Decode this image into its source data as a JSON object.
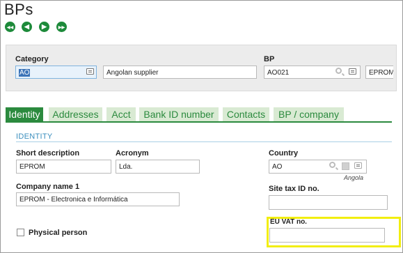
{
  "page": {
    "title": "BPs"
  },
  "nav": {
    "first": "◀◀",
    "prev": "◀",
    "next": "▶",
    "last": "▶▶"
  },
  "header": {
    "category_label": "Category",
    "category_value": "AO",
    "category_desc": "Angolan supplier",
    "bp_label": "BP",
    "bp_value": "AO021",
    "bp_desc": "EPROM"
  },
  "tabs": [
    "Identity",
    "Addresses",
    "Acct",
    "Bank ID number",
    "Contacts",
    "BP / company"
  ],
  "section": {
    "title": "IDENTITY"
  },
  "form": {
    "short_desc_label": "Short description",
    "short_desc_value": "EPROM",
    "acronym_label": "Acronym",
    "acronym_value": "Lda.",
    "country_label": "Country",
    "country_value": "AO",
    "country_name": "Angola",
    "company_name_label": "Company name 1",
    "company_name_value": "EPROM - Electronica e Informática",
    "site_tax_label": "Site tax ID no.",
    "site_tax_value": "",
    "eu_vat_label": "EU VAT no.",
    "eu_vat_value": "",
    "physical_person_label": "Physical person"
  },
  "colors": {
    "accent_green": "#2b8a3e",
    "section_blue": "#3a8ebd",
    "highlight": "#f2ee10"
  }
}
